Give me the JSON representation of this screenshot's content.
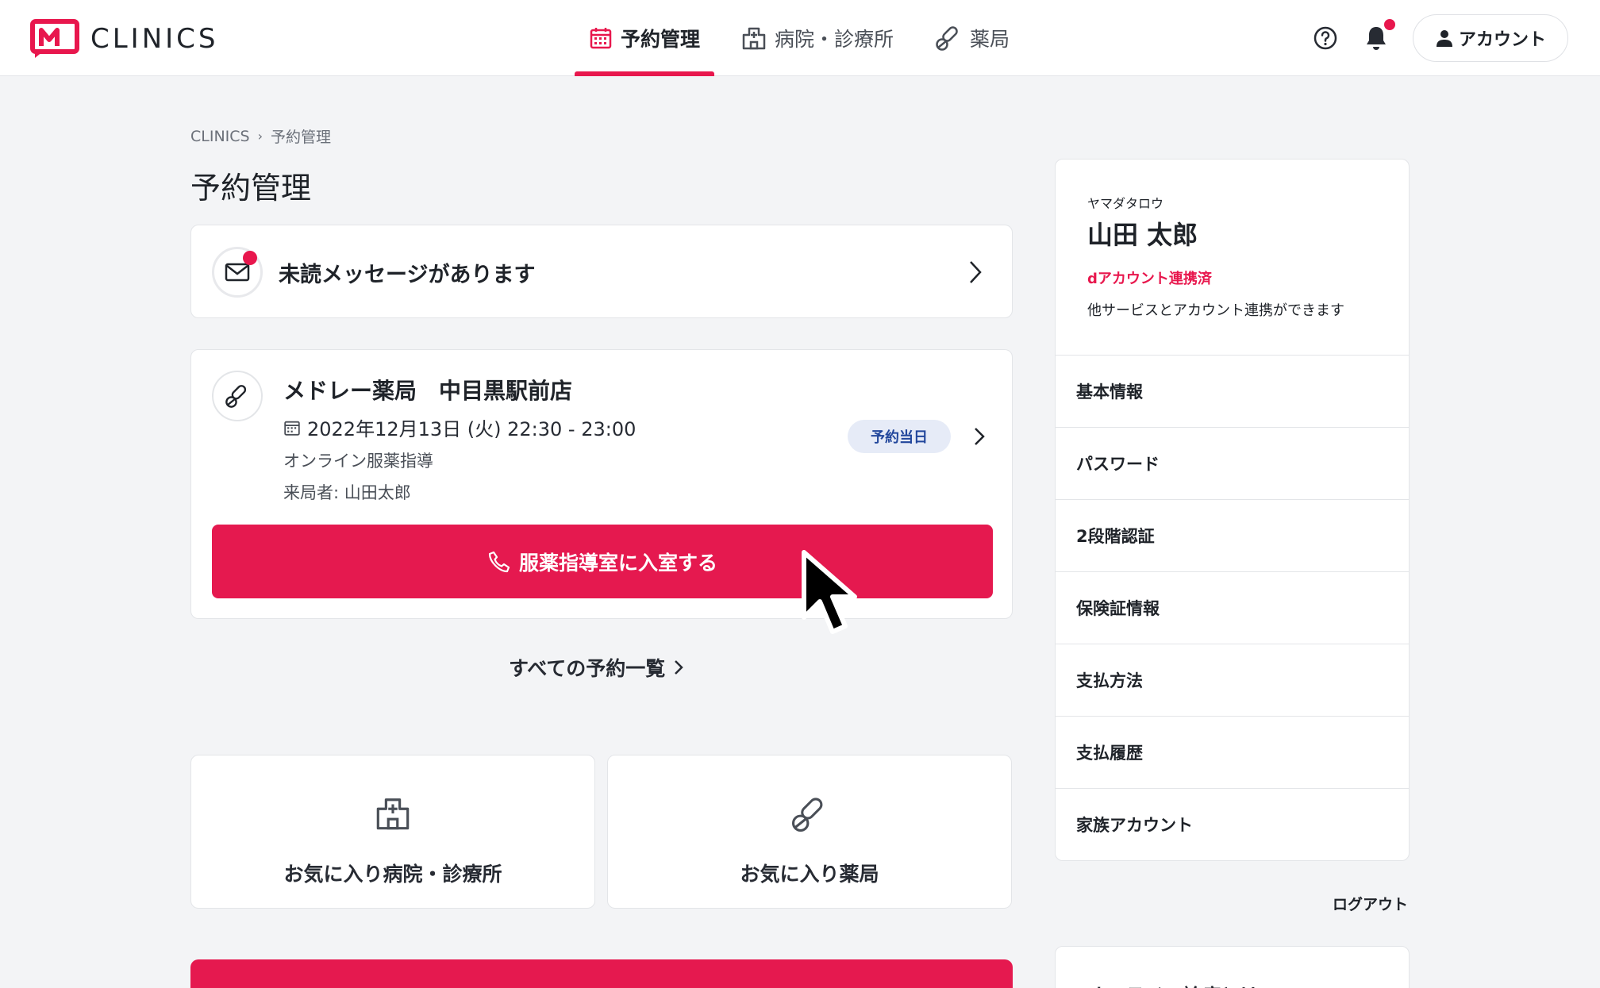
{
  "brand": {
    "name": "CLINICS",
    "color": "#e8174d"
  },
  "nav": {
    "items": [
      {
        "label": "予約管理",
        "icon": "calendar-icon",
        "active": true
      },
      {
        "label": "病院・診療所",
        "icon": "hospital-icon",
        "active": false
      },
      {
        "label": "薬局",
        "icon": "pill-icon",
        "active": false
      }
    ]
  },
  "header": {
    "help_icon": "help-icon",
    "bell_icon": "bell-icon",
    "account_label": "アカウント"
  },
  "breadcrumb": {
    "root": "CLINICS",
    "current": "予約管理"
  },
  "page": {
    "title": "予約管理"
  },
  "message_card": {
    "text": "未読メッセージがあります"
  },
  "reservation": {
    "name": "メドレー薬局　中目黒駅前店",
    "datetime": "2022年12月13日 (火) 22:30 - 23:00",
    "type": "オンライン服薬指導",
    "visitor": "来局者: 山田太郎",
    "badge": "予約当日",
    "button_label": "服薬指導室に入室する"
  },
  "all_reservations_link": "すべての予約一覧",
  "favorites": [
    {
      "label": "お気に入り病院・診療所",
      "icon": "hospital-icon"
    },
    {
      "label": "お気に入り薬局",
      "icon": "pill-icon"
    }
  ],
  "profile": {
    "kana": "ヤマダタロウ",
    "name": "山田 太郎",
    "linked": "dアカウント連携済",
    "link_desc": "他サービスとアカウント連携ができます",
    "menu": [
      "基本情報",
      "パスワード",
      "2段階認証",
      "保険証情報",
      "支払方法",
      "支払履歴",
      "家族アカウント"
    ]
  },
  "logout_label": "ログアウト",
  "sidebar_bottom_title": "オンライン診療とは"
}
